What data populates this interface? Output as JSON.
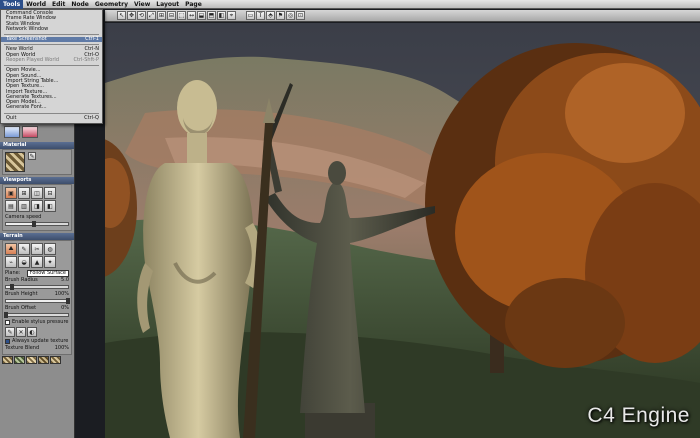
{
  "menubar": [
    "Tools",
    "World",
    "Edit",
    "Node",
    "Geometry",
    "View",
    "Layout",
    "Page"
  ],
  "tools_menu": {
    "groups": [
      [
        {
          "label": "Command Console",
          "shortcut": "",
          "disabled": false
        },
        {
          "label": "Frame Rate Window",
          "shortcut": "",
          "disabled": false
        },
        {
          "label": "Stats Window",
          "shortcut": "",
          "disabled": false
        },
        {
          "label": "Network Window",
          "shortcut": "",
          "disabled": false
        }
      ],
      [
        {
          "label": "Take Screenshot",
          "shortcut": "Ctrl-1",
          "disabled": false,
          "highlighted": true
        }
      ],
      [
        {
          "label": "New World",
          "shortcut": "Ctrl-N",
          "disabled": false
        },
        {
          "label": "Open World",
          "shortcut": "Ctrl-O",
          "disabled": false
        },
        {
          "label": "Reopen Played World",
          "shortcut": "Ctrl-Shft-P",
          "disabled": true
        }
      ],
      [
        {
          "label": "Open Movie...",
          "shortcut": "",
          "disabled": false
        },
        {
          "label": "Open Sound...",
          "shortcut": "",
          "disabled": false
        },
        {
          "label": "Import String Table...",
          "shortcut": "",
          "disabled": false
        },
        {
          "label": "Open Texture...",
          "shortcut": "",
          "disabled": false
        },
        {
          "label": "Import Texture...",
          "shortcut": "",
          "disabled": false
        },
        {
          "label": "Generate Textures...",
          "shortcut": "",
          "disabled": false
        },
        {
          "label": "Open Model...",
          "shortcut": "",
          "disabled": false
        },
        {
          "label": "Generate Font...",
          "shortcut": "",
          "disabled": false
        }
      ],
      [
        {
          "label": "Quit",
          "shortcut": "Ctrl-Q",
          "disabled": false
        }
      ]
    ]
  },
  "toolbar": {
    "tools": [
      "↖",
      "✥",
      "⟲",
      "⤢",
      "⊞",
      "⊟",
      "⬚",
      "↔",
      "⬓",
      "⬒",
      "◧",
      "⌖",
      "▭",
      "T",
      "⬘",
      "⚑",
      "◎",
      "⊡"
    ]
  },
  "panels": {
    "materials_title": "Material",
    "viewports_title": "Viewports",
    "camera_speed_label": "Camera speed",
    "terrain_title": "Terrain",
    "plane_label": "Plane:",
    "plane_value": "Follow Surface",
    "brush_radius_label": "Brush Radius",
    "brush_radius_value": "5.0",
    "brush_height_label": "Brush Height",
    "brush_height_value": "100%",
    "brush_offset_label": "Brush Offset",
    "brush_offset_value": "0%",
    "stylus_label": "Enable stylus pressure",
    "always_update_label": "Always update texture",
    "texture_blend_label": "Texture Blend",
    "texture_blend_value": "100%"
  },
  "values": {
    "camera_speed": 0.45,
    "brush_radius": 0.1,
    "brush_height": 1.0,
    "brush_offset": 0.0,
    "texture_blend": 1.0,
    "stylus_enabled": false,
    "always_update_enabled": true
  },
  "engine_label": "C4 Engine",
  "colors": {
    "menu_highlight": "#5f7aa6",
    "panel_title": "#3d4e6c",
    "foliage": "#a0541a",
    "statue_light": "#cfc39a",
    "statue_dark": "#46473c"
  }
}
